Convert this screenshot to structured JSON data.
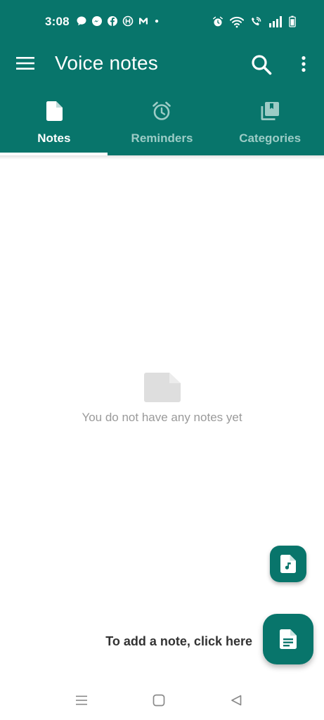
{
  "status_bar": {
    "time": "3:08",
    "notification_icons": [
      "chat-bubble-icon",
      "messenger-icon",
      "facebook-icon",
      "globe-icon",
      "gmail-icon",
      "dot-icon"
    ],
    "system_icons": [
      "alarm-icon",
      "wifi-icon",
      "wifi-call-icon",
      "signal-icon",
      "battery-icon"
    ]
  },
  "toolbar": {
    "title": "Voice notes",
    "menu_icon": "hamburger-menu-icon",
    "search_icon": "search-icon",
    "more_icon": "more-vert-icon"
  },
  "tabs": [
    {
      "label": "Notes",
      "icon": "note-icon",
      "active": true
    },
    {
      "label": "Reminders",
      "icon": "alarm-clock-icon",
      "active": false
    },
    {
      "label": "Categories",
      "icon": "collections-icon",
      "active": false
    }
  ],
  "empty_state": {
    "icon": "empty-note-icon",
    "message": "You do not have any notes yet"
  },
  "fab": {
    "audio_icon": "audio-note-icon",
    "text_icon": "text-note-icon",
    "hint": "To add a note, click here"
  },
  "navigation_bar": {
    "icons": [
      "recents-icon",
      "home-icon",
      "back-icon"
    ]
  },
  "colors": {
    "primary": "#08756b",
    "inactive_tab_text": "#9cccc6",
    "empty_text": "#9a9a9a",
    "hint_text": "#333333"
  }
}
